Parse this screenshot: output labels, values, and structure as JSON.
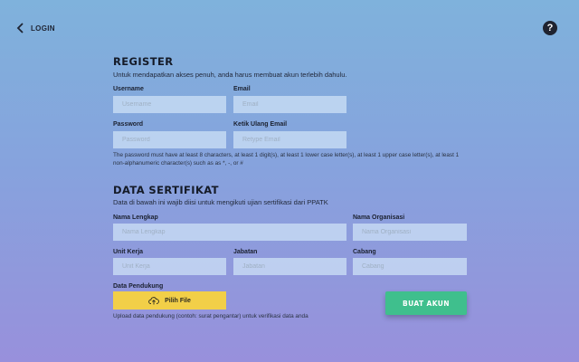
{
  "nav": {
    "back_label": "LOGIN",
    "help_symbol": "?"
  },
  "register": {
    "title": "REGISTER",
    "description": "Untuk mendapatkan akses penuh, anda harus membuat akun terlebih dahulu.",
    "username": {
      "label": "Username",
      "placeholder": "Username",
      "value": ""
    },
    "email": {
      "label": "Email",
      "placeholder": "Email",
      "value": ""
    },
    "password": {
      "label": "Password",
      "placeholder": "Password",
      "value": ""
    },
    "retype_email": {
      "label": "Ketik Ulang Email",
      "placeholder": "Retype Email",
      "value": ""
    },
    "password_rules": "The password must have at least 8 characters, at least 1 digit(s), at least 1 lower case letter(s), at least 1 upper case letter(s), at least 1 non-alphanumeric character(s) such as as *, -, or #"
  },
  "certificate": {
    "title": "DATA SERTIFIKAT",
    "description": "Data di bawah ini wajib diisi untuk mengikuti ujian sertifikasi dari PPATK",
    "full_name": {
      "label": "Nama Lengkap",
      "placeholder": "Nama Lengkap",
      "value": ""
    },
    "organization": {
      "label": "Nama Organisasi",
      "placeholder": "Nama Organisasi",
      "value": ""
    },
    "work_unit": {
      "label": "Unit Kerja",
      "placeholder": "Unit Kerja",
      "value": ""
    },
    "position": {
      "label": "Jabatan",
      "placeholder": "Jabatan",
      "value": ""
    },
    "branch": {
      "label": "Cabang",
      "placeholder": "Cabang",
      "value": ""
    },
    "supporting_data": {
      "label": "Data Pendukung",
      "button_label": "Pilih File",
      "note": "Upload data pendukung (contoh: surat pengantar) untuk verifikasi data anda"
    }
  },
  "submit_label": "BUAT AKUN",
  "colors": {
    "accent_green": "#3fbf8d",
    "file_button_yellow": "#f2cf48"
  },
  "icons": {
    "back": "chevron-left-icon",
    "help": "help-icon",
    "upload": "cloud-upload-icon"
  }
}
